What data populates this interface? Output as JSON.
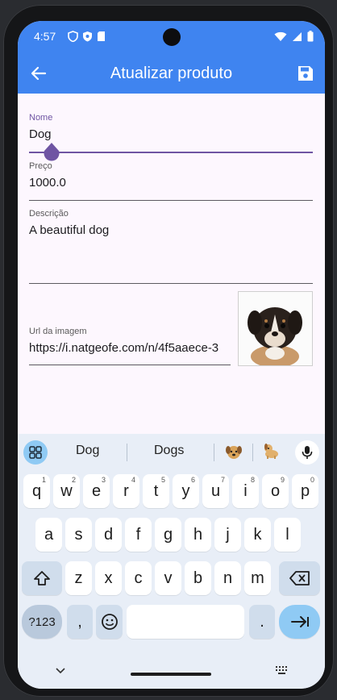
{
  "status": {
    "time": "4:57"
  },
  "appbar": {
    "title": "Atualizar produto"
  },
  "form": {
    "name_label": "Nome",
    "name_value": "Dog",
    "price_label": "Preço",
    "price_value": "1000.0",
    "description_label": "Descrição",
    "description_value": "A beautiful dog",
    "image_url_label": "Url da imagem",
    "image_url_value": "https://i.natgeofe.com/n/4f5aaece-3"
  },
  "keyboard": {
    "suggestions": [
      "Dog",
      "Dogs"
    ],
    "row1": [
      "q",
      "w",
      "e",
      "r",
      "t",
      "y",
      "u",
      "i",
      "o",
      "p"
    ],
    "row1_hints": [
      "1",
      "2",
      "3",
      "4",
      "5",
      "6",
      "7",
      "8",
      "9",
      "0"
    ],
    "row2": [
      "a",
      "s",
      "d",
      "f",
      "g",
      "h",
      "j",
      "k",
      "l"
    ],
    "row3": [
      "z",
      "x",
      "c",
      "v",
      "b",
      "n",
      "m"
    ],
    "symbols_label": "?123",
    "comma_label": ",",
    "period_label": "."
  },
  "colors": {
    "primary": "#3f84f0",
    "accent": "#7b5ea7",
    "keyboard_bg": "#e8eef7"
  }
}
